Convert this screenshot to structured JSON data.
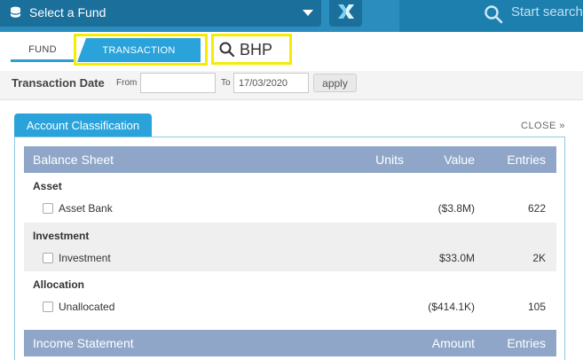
{
  "topbar": {
    "fund_select_label": "Select a Fund",
    "search_placeholder": "Start search"
  },
  "tabs": {
    "fund": "FUND",
    "transaction": "TRANSACTION",
    "active": "TRANSACTION"
  },
  "search": {
    "value": "BHP"
  },
  "filter": {
    "label": "Transaction Date",
    "from_label": "From",
    "from_value": "",
    "to_label": "To",
    "to_value": "17/03/2020",
    "apply_label": "apply"
  },
  "panel": {
    "tab_label": "Account Classification",
    "close_label": "CLOSE »"
  },
  "balance_sheet": {
    "title": "Balance Sheet",
    "col_units": "Units",
    "col_value": "Value",
    "col_entries": "Entries",
    "groups": [
      {
        "label": "Asset",
        "rows": [
          {
            "name": "Asset Bank",
            "value": "($3.8M)",
            "entries": "622"
          }
        ]
      },
      {
        "label": "Investment",
        "rows": [
          {
            "name": "Investment",
            "value": "$33.0M",
            "entries": "2K"
          }
        ]
      },
      {
        "label": "Allocation",
        "rows": [
          {
            "name": "Unallocated",
            "value": "($414.1K)",
            "entries": "105"
          }
        ]
      }
    ]
  },
  "income_statement": {
    "title": "Income Statement",
    "col_amount": "Amount",
    "col_entries": "Entries"
  },
  "colors": {
    "topbar": "#2a8dbd",
    "accent": "#2aa3da",
    "section_header": "#8fa6c8",
    "highlight": "#f5ec00"
  },
  "icons": [
    "database-icon",
    "excel-icon",
    "search-icon",
    "caret-down-icon"
  ]
}
